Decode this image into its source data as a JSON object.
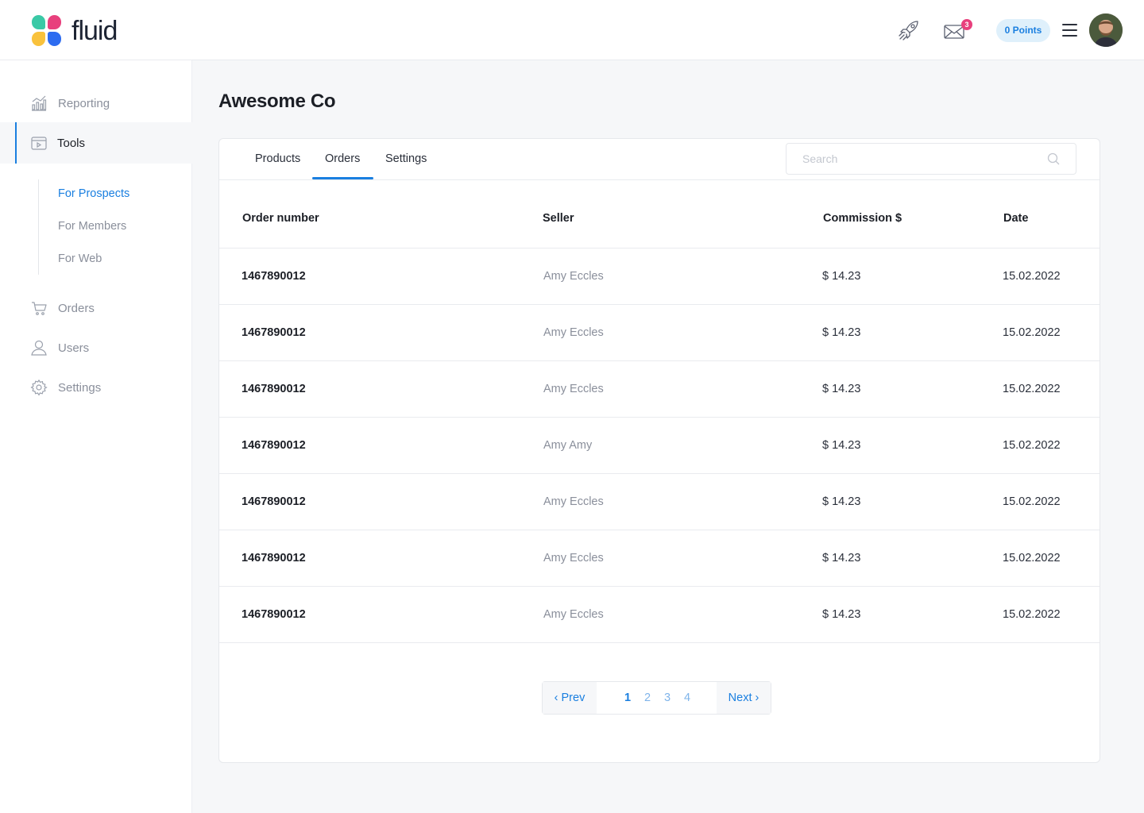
{
  "brand": {
    "name": "fluid"
  },
  "header": {
    "mail_badge": "3",
    "points_label": "0 Points"
  },
  "sidebar": {
    "items": [
      {
        "label": "Reporting",
        "icon": "chart-icon"
      },
      {
        "label": "Tools",
        "icon": "tools-icon",
        "active": true
      },
      {
        "label": "Orders",
        "icon": "cart-icon"
      },
      {
        "label": "Users",
        "icon": "user-icon"
      },
      {
        "label": "Settings",
        "icon": "gear-icon"
      }
    ],
    "tools_sub": [
      {
        "label": "For Prospects",
        "active": true
      },
      {
        "label": "For Members"
      },
      {
        "label": "For Web"
      }
    ]
  },
  "page": {
    "title": "Awesome Co"
  },
  "tabs": [
    {
      "label": "Products"
    },
    {
      "label": "Orders",
      "active": true
    },
    {
      "label": "Settings"
    }
  ],
  "search": {
    "placeholder": "Search"
  },
  "table": {
    "columns": [
      "Order number",
      "Seller",
      "Commission $",
      "Date"
    ],
    "rows": [
      {
        "order": "1467890012",
        "seller": "Amy Eccles",
        "commission": "$ 14.23",
        "date": "15.02.2022"
      },
      {
        "order": "1467890012",
        "seller": "Amy Eccles",
        "commission": "$ 14.23",
        "date": "15.02.2022"
      },
      {
        "order": "1467890012",
        "seller": "Amy Eccles",
        "commission": "$ 14.23",
        "date": "15.02.2022"
      },
      {
        "order": "1467890012",
        "seller": "Amy Amy",
        "commission": "$ 14.23",
        "date": "15.02.2022"
      },
      {
        "order": "1467890012",
        "seller": "Amy Eccles",
        "commission": "$ 14.23",
        "date": "15.02.2022"
      },
      {
        "order": "1467890012",
        "seller": "Amy Eccles",
        "commission": "$ 14.23",
        "date": "15.02.2022"
      },
      {
        "order": "1467890012",
        "seller": "Amy Eccles",
        "commission": "$ 14.23",
        "date": "15.02.2022"
      }
    ]
  },
  "pagination": {
    "prev_label": "‹ Prev",
    "next_label": "Next ›",
    "pages": [
      "1",
      "2",
      "3",
      "4"
    ],
    "current": "1"
  },
  "colors": {
    "accent": "#1a7fe0",
    "badge": "#e8407d"
  }
}
